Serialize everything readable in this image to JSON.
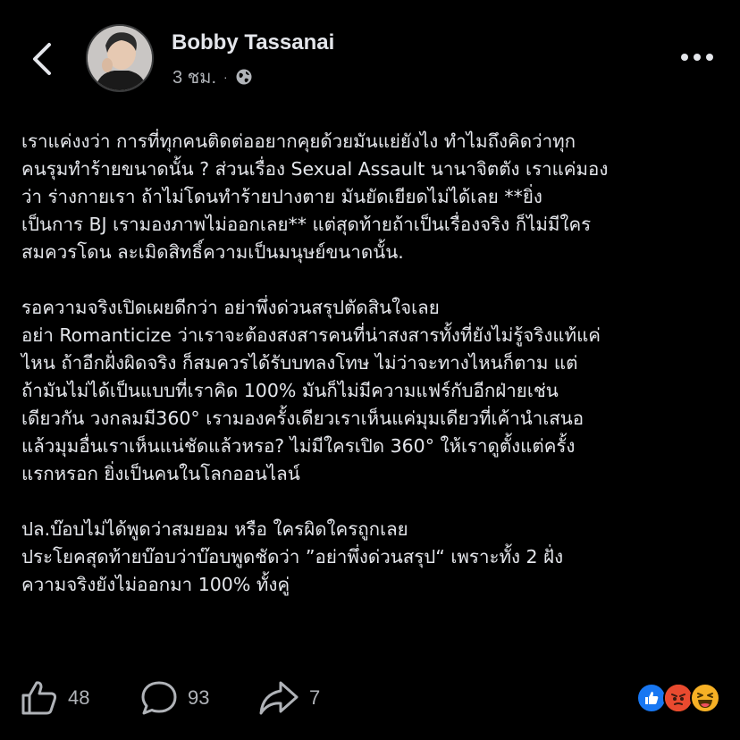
{
  "header": {
    "back_icon": "chevron-left-icon",
    "author_name": "Bobby Tassanai",
    "timestamp": "3 ชม.",
    "separator": "·",
    "privacy_icon": "globe-icon",
    "more_icon": "ellipsis-icon"
  },
  "post": {
    "lines": [
      "เราแค่งงว่า การที่ทุกคนติดต่ออยากคุยด้วยมันแย่ยังไง ทำไมถึงคิดว่าทุก",
      "คนรุมทำร้ายขนาดนั้น ? ส่วนเรื่อง Sexual Assault นานาจิตตัง เราแค่มอง",
      "ว่า ร่างกายเรา ถ้าไม่โดนทำร้ายปางตาย มันยัดเยียดไม่ได้เลย **ยิ่ง",
      "เป็นการ BJ เรามองภาพไม่ออกเลย** แต่สุดท้ายถ้าเป็นเรื่องจริง ก็ไม่มีใคร",
      "สมควรโดน ละเมิดสิทธิ์ความเป็นมนุษย์ขนาดนั้น.",
      "",
      "รอความจริงเปิดเผยดีกว่า อย่าพึ่งด่วนสรุปตัดสินใจเลย",
      "อย่า Romanticize ว่าเราจะต้องสงสารคนที่น่าสงสารทั้งที่ยังไม่รู้จริงแท้แค่",
      "ไหน ถ้าอีกฝั่งผิดจริง ก็สมควรได้รับบทลงโทษ ไม่ว่าจะทางไหนก็ตาม แต่",
      "ถ้ามันไม่ได้เป็นแบบที่เราคิด 100% มันก็ไม่มีความแฟร์กับอีกฝ่ายเช่น",
      "เดียวกัน วงกลมมี360° เรามองครั้งเดียวเราเห็นแค่มุมเดียวที่เค้านำเสนอ",
      "แล้วมุมอื่นเราเห็นแน่ชัดแล้วหรอ? ไม่มีใครเปิด 360° ให้เราดูตั้งแต่ครั้ง",
      "แรกหรอก ยิ่งเป็นคนในโลกออนไลน์",
      "",
      "ปล.บ๊อบไม่ได้พูดว่าสมยอม หรือ ใครผิดใครถูกเลย",
      "ประโยคสุดท้ายบ๊อบว่าบ๊อบพูดชัดว่า ”อย่าพึ่งด่วนสรุป“ เพราะทั้ง 2 ฝั่ง",
      "ความจริงยังไม่ออกมา 100% ทั้งคู่"
    ]
  },
  "actions": {
    "like": {
      "icon": "thumbs-up-icon",
      "count": "48"
    },
    "comment": {
      "icon": "comment-bubble-icon",
      "count": "93"
    },
    "share": {
      "icon": "share-arrow-icon",
      "count": "7"
    },
    "reactions": [
      "like-reaction-icon",
      "angry-reaction-icon",
      "haha-reaction-icon"
    ]
  },
  "colors": {
    "background": "#000000",
    "text_primary": "#e4e6eb",
    "text_secondary": "#b0b3b8",
    "like_blue": "#1877f2",
    "angry_orange": "#e9710f",
    "haha_yellow": "#f7b125"
  }
}
